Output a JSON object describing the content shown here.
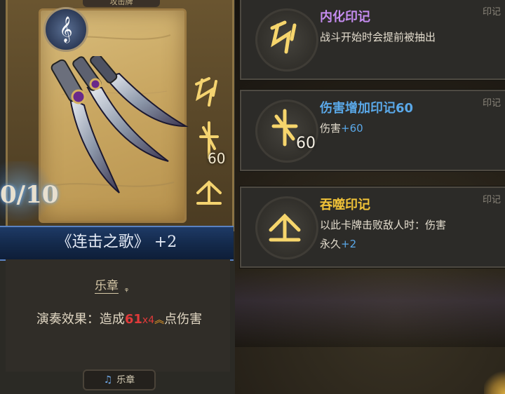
{
  "card": {
    "header_text": "攻击牌",
    "cost_text": "0/10",
    "side_value": "60",
    "name": "《连击之歌》",
    "upgrade": "+2",
    "keyword": "乐章",
    "effect": {
      "prefix": "演奏效果：造成",
      "damage": "61",
      "multiplier": "x4",
      "suffix": "点伤害"
    },
    "tag_label": "乐章"
  },
  "tooltips": [
    {
      "title": "内化印记",
      "title_color": "#c58cf0",
      "label": "印记",
      "desc": "战斗开始时会提前被抽出",
      "icon": "internalize-rune-icon"
    },
    {
      "title": "伤害增加印记60",
      "title_color": "#5aa8e8",
      "label": "印记",
      "desc_prefix": "伤害",
      "desc_value": "+60",
      "icon_number": "60",
      "icon": "damage-rune-icon"
    },
    {
      "title": "吞噬印记",
      "title_color": "#f0c238",
      "label": "印记",
      "desc_line1": "以此卡牌击败敌人时：伤害",
      "desc_line2_prefix": "永久",
      "desc_line2_value": "+2",
      "icon": "devour-rune-icon"
    }
  ]
}
